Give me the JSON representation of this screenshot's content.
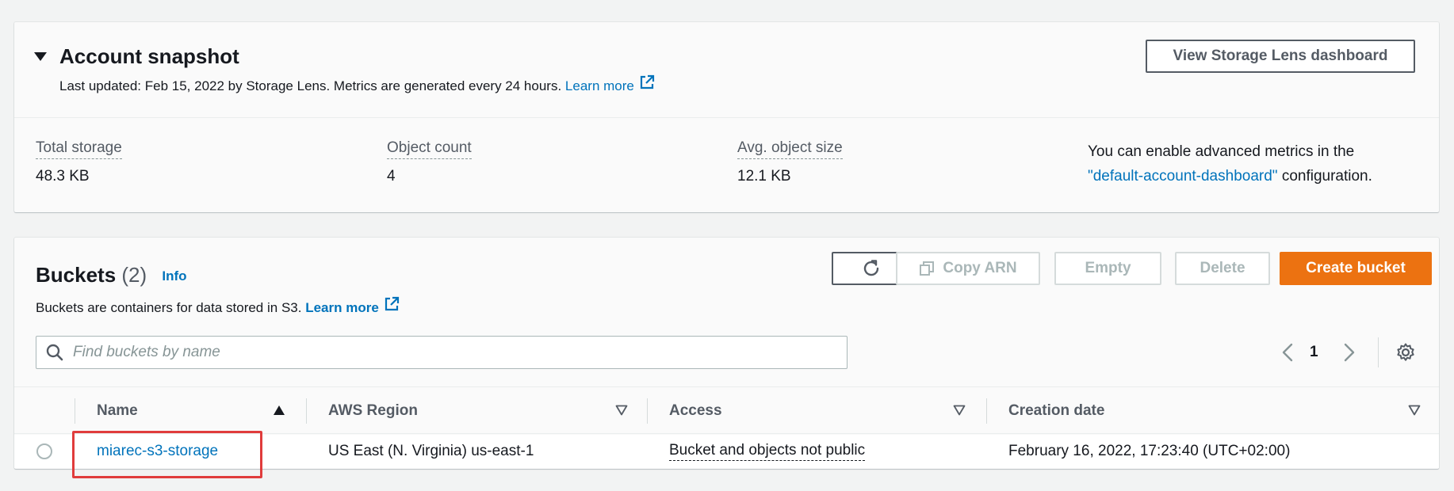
{
  "snapshot": {
    "title": "Account snapshot",
    "subtitle": "Last updated: Feb 15, 2022 by Storage Lens. Metrics are generated every 24 hours.",
    "learn_more": "Learn more",
    "view_dashboard_label": "View Storage Lens dashboard",
    "metrics": [
      {
        "label": "Total storage",
        "value": "48.3 KB"
      },
      {
        "label": "Object count",
        "value": "4"
      },
      {
        "label": "Avg. object size",
        "value": "12.1 KB"
      }
    ],
    "note_prefix": "You can enable advanced metrics in the",
    "note_link": "\"default-account-dashboard\"",
    "note_suffix": " configuration."
  },
  "buckets": {
    "title": "Buckets",
    "count": "(2)",
    "info_label": "Info",
    "description": "Buckets are containers for data stored in S3.",
    "learn_more": "Learn more",
    "toolbar": {
      "copy_arn": "Copy ARN",
      "empty": "Empty",
      "delete": "Delete",
      "create": "Create bucket"
    },
    "search_placeholder": "Find buckets by name",
    "page": "1",
    "columns": [
      "Name",
      "AWS Region",
      "Access",
      "Creation date"
    ],
    "rows": [
      {
        "name": "miarec-s3-storage",
        "region": "US East (N. Virginia) us-east-1",
        "access": "Bucket and objects not public",
        "created": "February 16, 2022, 17:23:40 (UTC+02:00)"
      }
    ]
  },
  "colors": {
    "link": "#0073bb",
    "primary_button": "#ec7211",
    "highlight": "#e03c3c"
  },
  "icons": {
    "snapshot_toggle": "caret-down-icon",
    "external": "external-link-icon",
    "refresh": "refresh-icon",
    "copy": "copy-icon",
    "search": "search-icon",
    "prev": "chevron-left-icon",
    "next": "chevron-right-icon",
    "settings": "gear-icon",
    "sort_asc": "sort-ascending-icon",
    "sort": "sort-descending-icon"
  }
}
